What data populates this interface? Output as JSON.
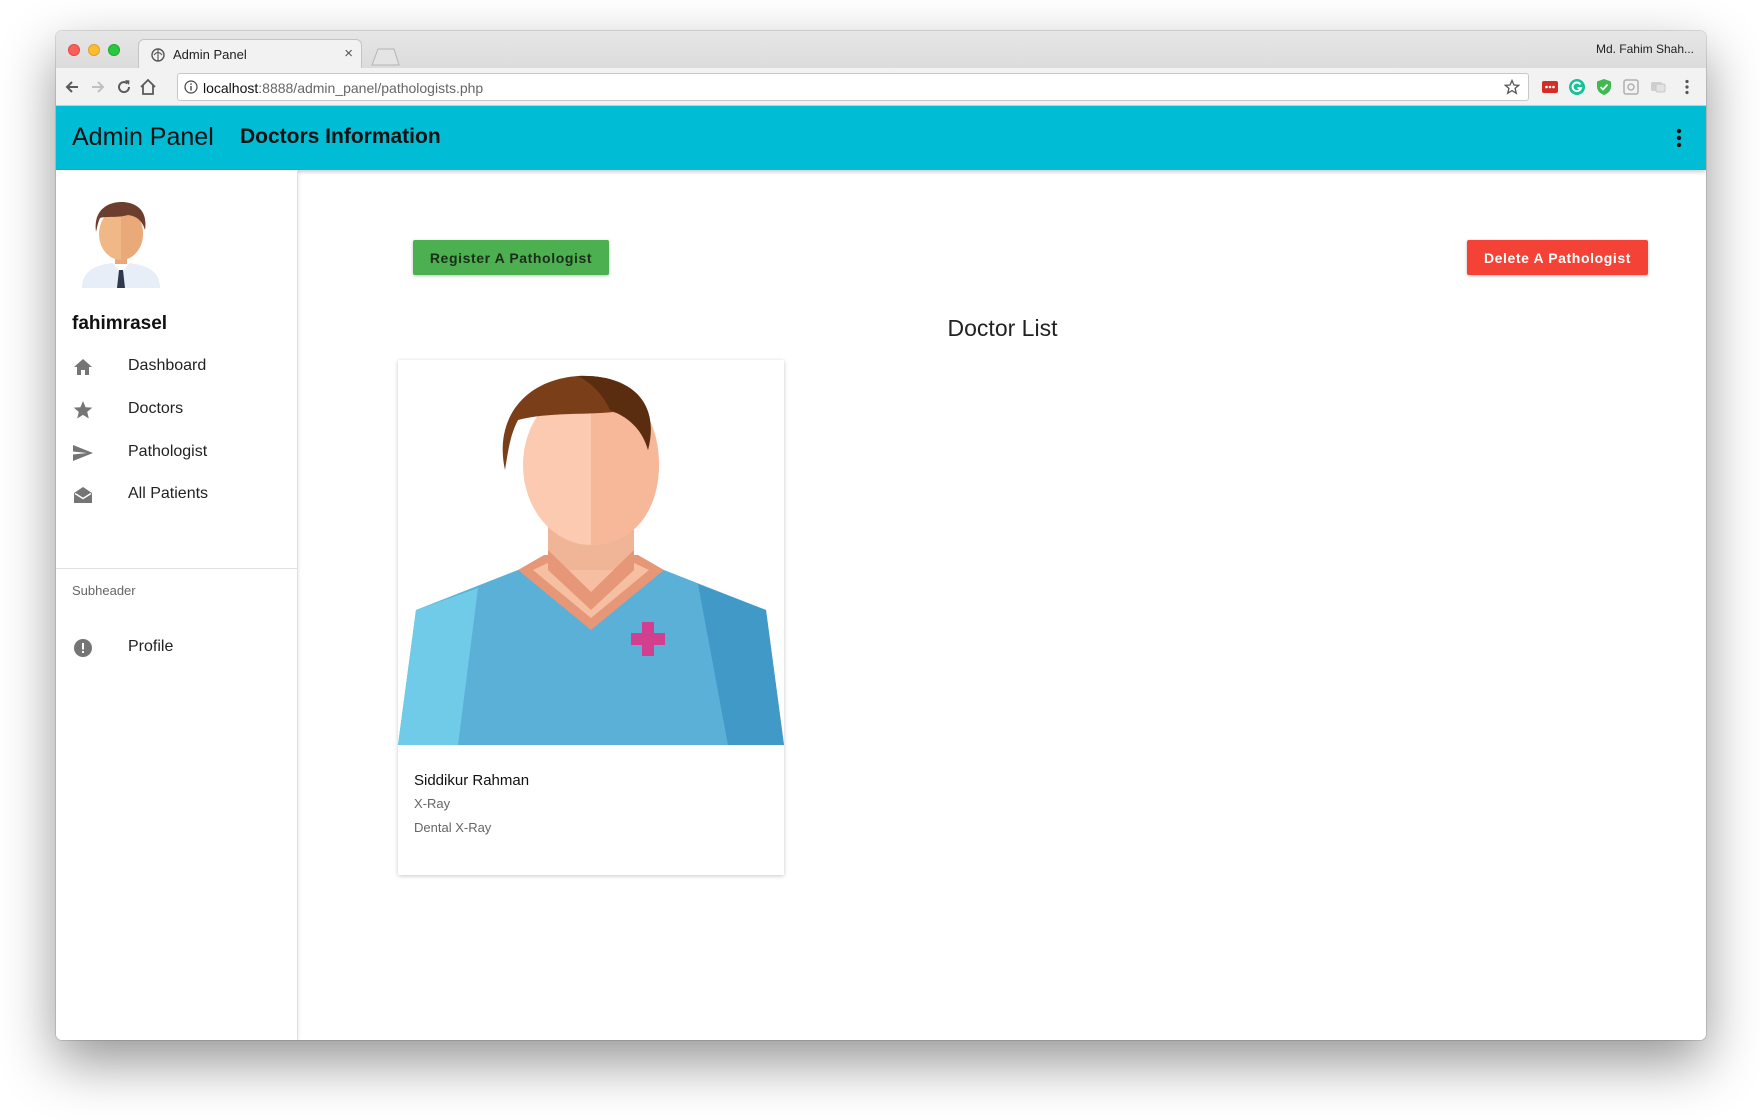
{
  "browser": {
    "tab_title": "Admin Panel",
    "tab_close": "×",
    "profile_name": "Md. Fahim Shah...",
    "url_host": "localhost",
    "url_path": ":8888/admin_panel/pathologists.php"
  },
  "appbar": {
    "title": "Admin Panel",
    "subtitle": "Doctors Information",
    "more_icon": "more-vert-icon",
    "color": "#00bcd4"
  },
  "sidebar": {
    "username": "fahimrasel",
    "items": [
      {
        "label": "Dashboard",
        "icon": "home-icon"
      },
      {
        "label": "Doctors",
        "icon": "star-icon"
      },
      {
        "label": "Pathologist",
        "icon": "send-icon"
      },
      {
        "label": "All Patients",
        "icon": "mail-open-icon"
      }
    ],
    "subheader": "Subheader",
    "sub_items": [
      {
        "label": "Profile",
        "icon": "alert-circle-icon"
      }
    ]
  },
  "main": {
    "register_button": "Register A Pathologist",
    "delete_button": "Delete A Pathologist",
    "section_title": "Doctor List",
    "cards": [
      {
        "name": "Siddikur Rahman",
        "department": "X-Ray",
        "specialty": "Dental X-Ray"
      }
    ]
  },
  "colors": {
    "register": "#4caf50",
    "delete": "#f44336"
  }
}
